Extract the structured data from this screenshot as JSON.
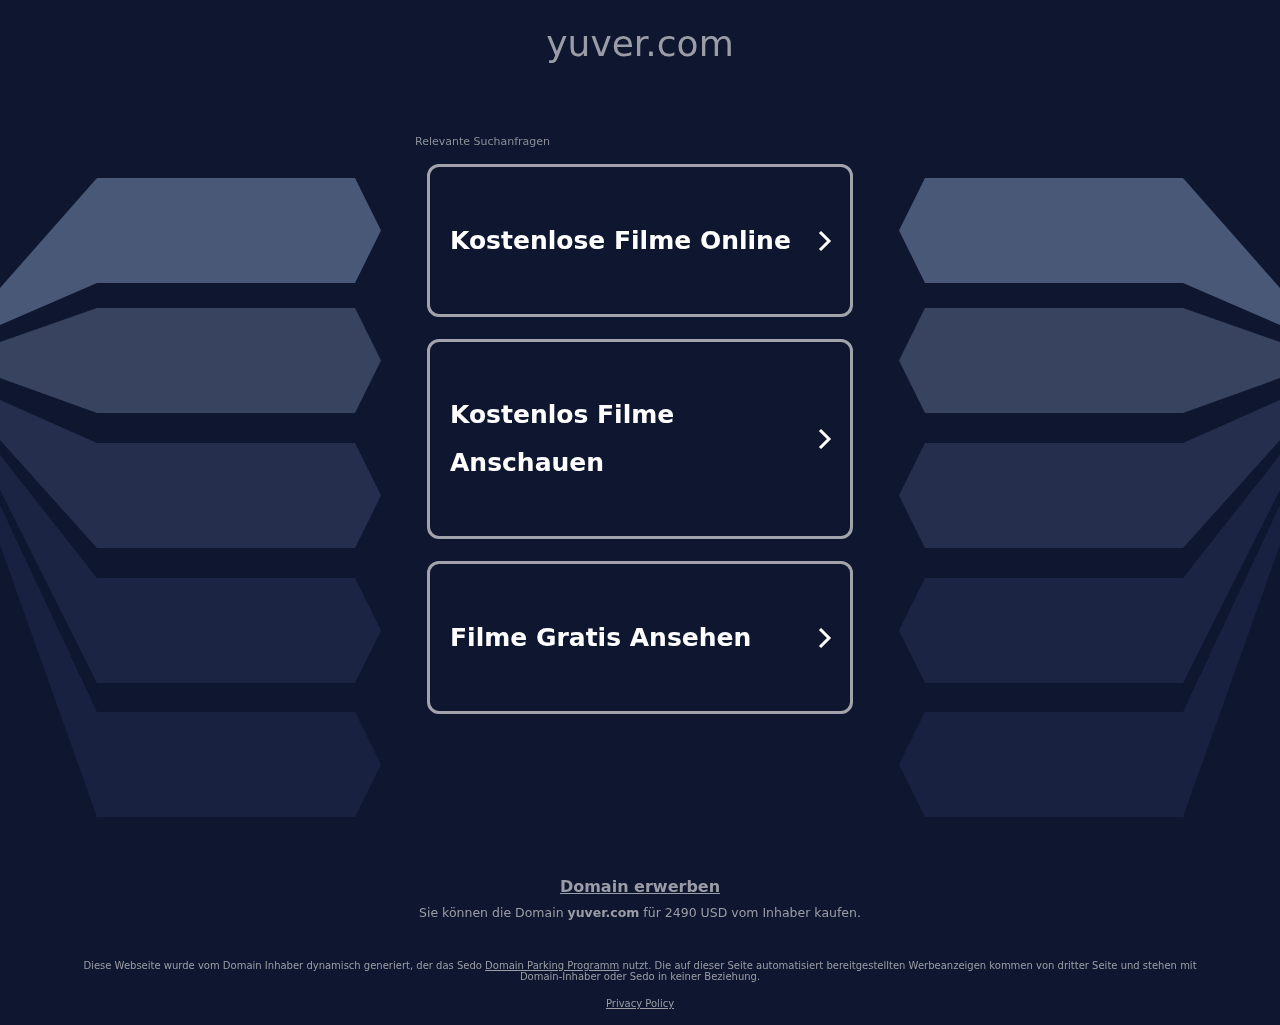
{
  "title": "yuver.com",
  "search_label": "Relevante Suchanfragen",
  "links": [
    {
      "label": "Kostenlose Filme Online"
    },
    {
      "label": "Kostenlos Filme Anschauen"
    },
    {
      "label": "Filme Gratis Ansehen"
    }
  ],
  "purchase": {
    "link": "Domain erwerben",
    "text": "Sie können die Domain **yuver.com** für 2490 USD vom Inhaber kaufen."
  },
  "disclaimer": {
    "before": "Diese Webseite wurde vom Domain Inhaber dynamisch generiert, der das Sedo",
    "link": "Domain Parking Programm",
    "after": "nutzt. Die auf dieser Seite automatisiert bereitgestellten Werbeanzeigen kommen von dritter Seite und stehen mit Domain-Inhaber oder Sedo in keiner Beziehung."
  },
  "privacy": "Privacy Policy"
}
